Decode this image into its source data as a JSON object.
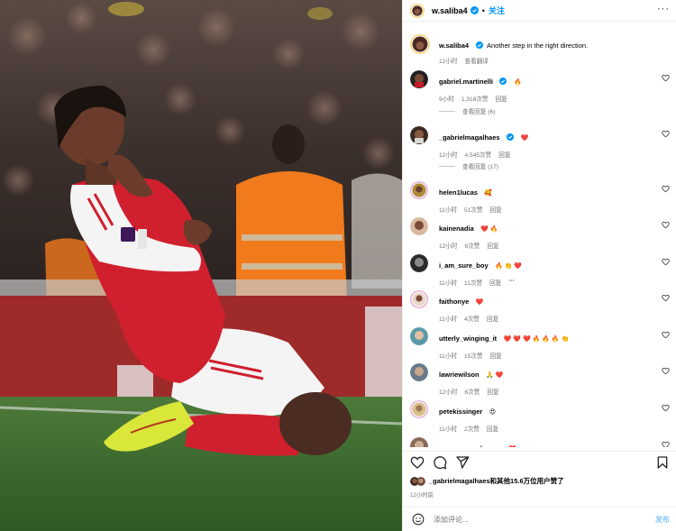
{
  "header": {
    "username": "w.saliba4",
    "separator": "•",
    "follow_label": "关注",
    "more_label": "···"
  },
  "caption": {
    "username": "w.saliba4",
    "text": "Another step in the right direction.",
    "time": "12小时",
    "translate_label": "查看翻译"
  },
  "comments": [
    {
      "username": "gabriel.martinelli",
      "verified": true,
      "text": "",
      "emoji": "🔥",
      "time": "9小时",
      "likes": "1,318次赞",
      "reply_label": "回复",
      "replies_label": "查看回复 (6)"
    },
    {
      "username": "_gabrielmagalhaes",
      "verified": true,
      "text": "",
      "emoji": "❤️",
      "time": "12小时",
      "likes": "4,545次赞",
      "reply_label": "回复",
      "replies_label": "查看回复 (17)"
    },
    {
      "username": "helen1lucas",
      "verified": false,
      "text": "",
      "emoji": "🥰",
      "time": "11小时",
      "likes": "51次赞",
      "reply_label": "回复"
    },
    {
      "username": "kainenadia",
      "verified": false,
      "text": "",
      "emoji": "❤️ 🔥",
      "time": "12小时",
      "likes": "6次赞",
      "reply_label": "回复"
    },
    {
      "username": "i_am_sure_boy",
      "verified": false,
      "text": "",
      "emoji": "🔥 👏 ❤️",
      "time": "11小时",
      "likes": "11次赞",
      "reply_label": "回复",
      "more_label": "···"
    },
    {
      "username": "faithonye",
      "verified": false,
      "text": "",
      "emoji": "❤️",
      "time": "11小时",
      "likes": "4次赞",
      "reply_label": "回复"
    },
    {
      "username": "utterly_winging_it",
      "verified": false,
      "text": "",
      "emoji": "❤️ ❤️ ❤️ 🔥 🔥 🔥 👏",
      "time": "11小时",
      "likes": "15次赞",
      "reply_label": "回复"
    },
    {
      "username": "lawriewilson",
      "verified": false,
      "text": "",
      "emoji": "🙏 ❤️",
      "time": "12小时",
      "likes": "6次赞",
      "reply_label": "回复"
    },
    {
      "username": "petekissinger",
      "verified": false,
      "text": "",
      "emoji": "😍",
      "time": "11小时",
      "likes": "2次赞",
      "reply_label": "回复"
    },
    {
      "username": "mur_mur_unknown",
      "verified": false,
      "text": "",
      "emoji": "❤️",
      "time": "",
      "likes": "",
      "reply_label": ""
    }
  ],
  "likes_summary": {
    "text": "_gabrielmagalhaes和其他15.6万位用户赞了",
    "time": "12小时前"
  },
  "composer": {
    "placeholder": "添加评论...",
    "post_label": "发布"
  },
  "colors": {
    "accent": "#0095f6",
    "post_disabled": "#84c6f8",
    "meta": "#737373",
    "arsenal_red": "#d0202e"
  }
}
